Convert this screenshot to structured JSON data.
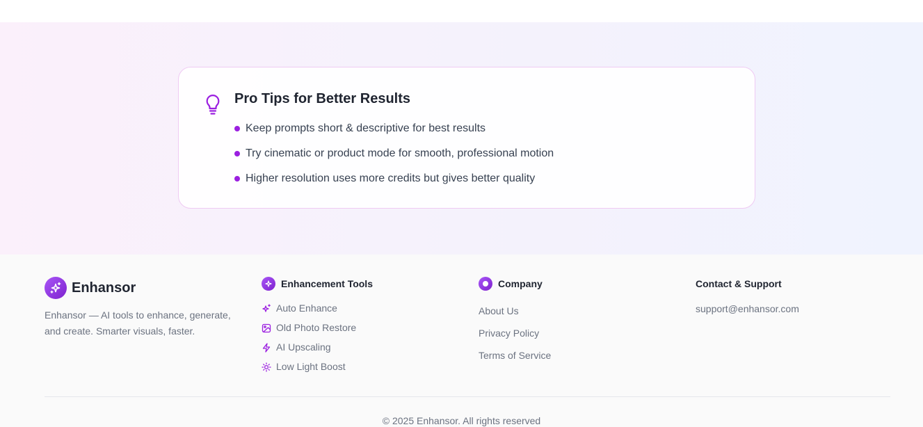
{
  "tips": {
    "title": "Pro Tips for Better Results",
    "icon": "lightbulb-icon",
    "accent_color": "#9b1fe0",
    "items": [
      "Keep prompts short & descriptive for best results",
      "Try cinematic or product mode for smooth, professional motion",
      "Higher resolution uses more credits but gives better quality"
    ]
  },
  "footer": {
    "brand": {
      "name": "Enhansor",
      "description": "Enhansor — AI tools to enhance, generate, and create. Smarter visuals, faster.",
      "icon": "sparkles-icon"
    },
    "tools": {
      "heading": "Enhancement Tools",
      "items": [
        {
          "label": "Auto Enhance",
          "icon": "sparkles-icon"
        },
        {
          "label": "Old Photo Restore",
          "icon": "image-icon"
        },
        {
          "label": "AI Upscaling",
          "icon": "lightning-icon"
        },
        {
          "label": "Low Light Boost",
          "icon": "sun-icon"
        }
      ]
    },
    "company": {
      "heading": "Company",
      "links": [
        "About Us",
        "Privacy Policy",
        "Terms of Service"
      ]
    },
    "contact": {
      "heading": "Contact & Support",
      "email": "support@enhansor.com"
    },
    "copyright": "© 2025 Enhansor. All rights reserved"
  }
}
